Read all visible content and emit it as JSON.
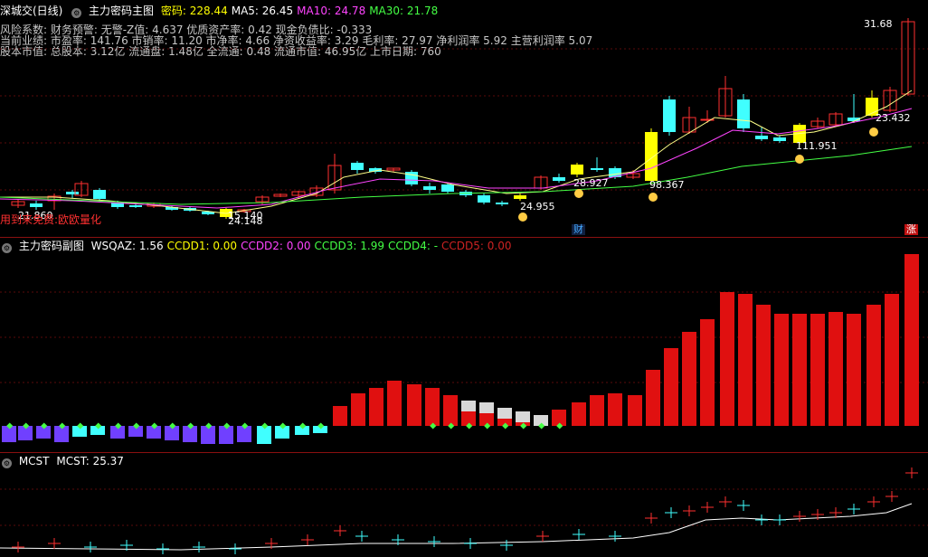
{
  "main": {
    "market": "深城交(日线)",
    "indicator": "主力密码主图",
    "values": [
      {
        "label": "密码:",
        "value": "228.44",
        "color": "#ffff00"
      },
      {
        "label": "MA5:",
        "value": "26.45",
        "color": "#ffffff"
      },
      {
        "label": "MA10:",
        "value": "24.78",
        "color": "#ff44ff"
      },
      {
        "label": "MA30:",
        "value": "21.78",
        "color": "#44ff44"
      }
    ],
    "info_lines": [
      "风险系数: 财务预警: 无警-Z值: 4.637 优质资产率: 0.42 现金负债比: -0.333",
      "当前业绩: 市盈率: 141.76 市销率: 11.20 市净率: 4.66 净资收益率: 3.29 毛利率: 27.97 净利润率 5.92 主营利润率 5.07",
      "股本市值: 总股本: 3.12亿 流通盘: 1.48亿 全流通: 0.48 流通市值: 46.95亿 上市日期: 760"
    ],
    "overlay_text": "用到来免费:欧欧量化",
    "price_labels": [
      "31.68",
      "23.432",
      "111.951",
      "98.367",
      "28.927",
      "24.955",
      "15.140",
      "21.860",
      "24.148"
    ],
    "badges": {
      "cai": "财",
      "zhang": "涨"
    }
  },
  "sub": {
    "indicator": "主力密码副图",
    "values": [
      {
        "label": "WSQAZ:",
        "value": "1.56",
        "color": "#ffffff"
      },
      {
        "label": "CCDD1:",
        "value": "0.00",
        "color": "#ffff00"
      },
      {
        "label": "CCDD2:",
        "value": "0.00",
        "color": "#ff44ff"
      },
      {
        "label": "CCDD3:",
        "value": "1.99",
        "color": "#44ff44"
      },
      {
        "label": "CCDD4:",
        "value": "-",
        "color": "#44ff44"
      },
      {
        "label": "CCDD5:",
        "value": "0.00",
        "color": "#cc2222"
      }
    ]
  },
  "mcst": {
    "indicator": "MCST",
    "values": [
      {
        "label": "MCST:",
        "value": "25.37",
        "color": "#ffffff"
      }
    ]
  }
}
